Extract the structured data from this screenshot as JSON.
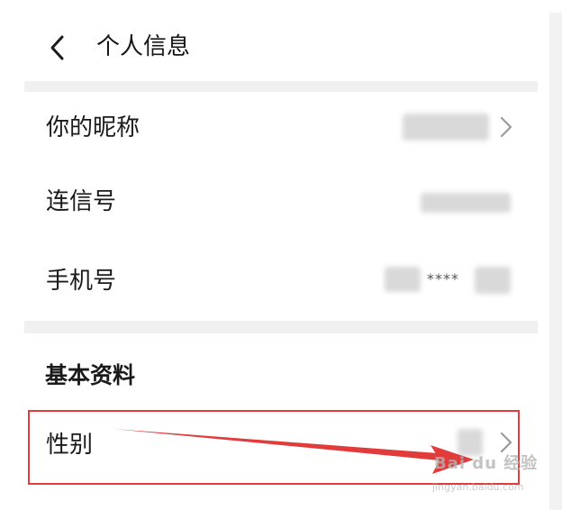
{
  "nav": {
    "title": "个人信息"
  },
  "rows": {
    "nickname": {
      "label": "你的昵称"
    },
    "lianxin_id": {
      "label": "连信号"
    },
    "phone": {
      "label": "手机号",
      "masked_value": "****"
    }
  },
  "basic_section": {
    "title": "基本资料",
    "gender": {
      "label": "性别"
    }
  },
  "watermark": {
    "brand": "Bai du 经验",
    "url": "jingyan.baidu.com"
  },
  "colors": {
    "annotation_red": "#e23b3b",
    "section_band": "#f0f0f0",
    "text": "#1a1a1a"
  }
}
